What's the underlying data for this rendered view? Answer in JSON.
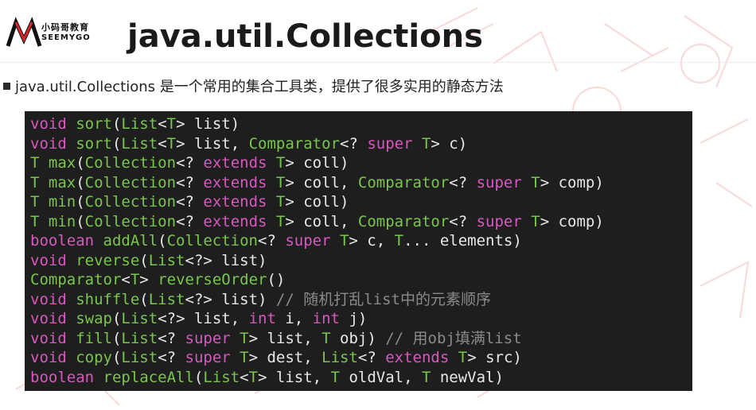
{
  "brand": {
    "name_cn": "小码哥教育",
    "name_en": "SEEMYGO"
  },
  "title": "java.util.Collections",
  "bullet": "java.util.Collections 是一个常用的集合工具类，提供了很多实用的静态方法",
  "colors": {
    "keyword": "#d957c0",
    "type": "#79c64e",
    "plain": "#e8e8e8",
    "comment": "#8a8a8a",
    "code_bg": "#1e1e1e"
  },
  "code_lines": [
    [
      [
        "kw",
        "void "
      ],
      [
        "ty",
        "sort"
      ],
      [
        "pl",
        "("
      ],
      [
        "ty",
        "List"
      ],
      [
        "pl",
        "<"
      ],
      [
        "ty",
        "T"
      ],
      [
        "pl",
        "> list)"
      ]
    ],
    [
      [
        "kw",
        "void "
      ],
      [
        "ty",
        "sort"
      ],
      [
        "pl",
        "("
      ],
      [
        "ty",
        "List"
      ],
      [
        "pl",
        "<"
      ],
      [
        "ty",
        "T"
      ],
      [
        "pl",
        "> list, "
      ],
      [
        "ty",
        "Comparator"
      ],
      [
        "pl",
        "<? "
      ],
      [
        "kw",
        "super "
      ],
      [
        "ty",
        "T"
      ],
      [
        "pl",
        "> c)"
      ]
    ],
    [
      [
        "ty",
        "T "
      ],
      [
        "ty",
        "max"
      ],
      [
        "pl",
        "("
      ],
      [
        "ty",
        "Collection"
      ],
      [
        "pl",
        "<? "
      ],
      [
        "kw",
        "extends "
      ],
      [
        "ty",
        "T"
      ],
      [
        "pl",
        "> coll)"
      ]
    ],
    [
      [
        "ty",
        "T "
      ],
      [
        "ty",
        "max"
      ],
      [
        "pl",
        "("
      ],
      [
        "ty",
        "Collection"
      ],
      [
        "pl",
        "<? "
      ],
      [
        "kw",
        "extends "
      ],
      [
        "ty",
        "T"
      ],
      [
        "pl",
        "> coll, "
      ],
      [
        "ty",
        "Comparator"
      ],
      [
        "pl",
        "<? "
      ],
      [
        "kw",
        "super "
      ],
      [
        "ty",
        "T"
      ],
      [
        "pl",
        "> comp)"
      ]
    ],
    [
      [
        "ty",
        "T "
      ],
      [
        "ty",
        "min"
      ],
      [
        "pl",
        "("
      ],
      [
        "ty",
        "Collection"
      ],
      [
        "pl",
        "<? "
      ],
      [
        "kw",
        "extends "
      ],
      [
        "ty",
        "T"
      ],
      [
        "pl",
        "> coll)"
      ]
    ],
    [
      [
        "ty",
        "T "
      ],
      [
        "ty",
        "min"
      ],
      [
        "pl",
        "("
      ],
      [
        "ty",
        "Collection"
      ],
      [
        "pl",
        "<? "
      ],
      [
        "kw",
        "extends "
      ],
      [
        "ty",
        "T"
      ],
      [
        "pl",
        "> coll, "
      ],
      [
        "ty",
        "Comparator"
      ],
      [
        "pl",
        "<? "
      ],
      [
        "kw",
        "super "
      ],
      [
        "ty",
        "T"
      ],
      [
        "pl",
        "> comp)"
      ]
    ],
    [
      [
        "kw",
        "boolean "
      ],
      [
        "ty",
        "addAll"
      ],
      [
        "pl",
        "("
      ],
      [
        "ty",
        "Collection"
      ],
      [
        "pl",
        "<? "
      ],
      [
        "kw",
        "super "
      ],
      [
        "ty",
        "T"
      ],
      [
        "pl",
        "> c, "
      ],
      [
        "ty",
        "T"
      ],
      [
        "pl",
        "... elements)"
      ]
    ],
    [
      [
        "kw",
        "void "
      ],
      [
        "ty",
        "reverse"
      ],
      [
        "pl",
        "("
      ],
      [
        "ty",
        "List"
      ],
      [
        "pl",
        "<?> list)"
      ]
    ],
    [
      [
        "ty",
        "Comparator"
      ],
      [
        "pl",
        "<"
      ],
      [
        "ty",
        "T"
      ],
      [
        "pl",
        "> "
      ],
      [
        "ty",
        "reverseOrder"
      ],
      [
        "pl",
        "()"
      ]
    ],
    [
      [
        "kw",
        "void "
      ],
      [
        "ty",
        "shuffle"
      ],
      [
        "pl",
        "("
      ],
      [
        "ty",
        "List"
      ],
      [
        "pl",
        "<?> list) "
      ],
      [
        "cm",
        "// 随机打乱list中的元素顺序"
      ]
    ],
    [
      [
        "kw",
        "void "
      ],
      [
        "ty",
        "swap"
      ],
      [
        "pl",
        "("
      ],
      [
        "ty",
        "List"
      ],
      [
        "pl",
        "<?> list, "
      ],
      [
        "kw",
        "int "
      ],
      [
        "pl",
        "i, "
      ],
      [
        "kw",
        "int "
      ],
      [
        "pl",
        "j)"
      ]
    ],
    [
      [
        "kw",
        "void "
      ],
      [
        "ty",
        "fill"
      ],
      [
        "pl",
        "("
      ],
      [
        "ty",
        "List"
      ],
      [
        "pl",
        "<? "
      ],
      [
        "kw",
        "super "
      ],
      [
        "ty",
        "T"
      ],
      [
        "pl",
        "> list, "
      ],
      [
        "ty",
        "T"
      ],
      [
        "pl",
        " obj) "
      ],
      [
        "cm",
        "// 用obj填满list"
      ]
    ],
    [
      [
        "kw",
        "void "
      ],
      [
        "ty",
        "copy"
      ],
      [
        "pl",
        "("
      ],
      [
        "ty",
        "List"
      ],
      [
        "pl",
        "<? "
      ],
      [
        "kw",
        "super "
      ],
      [
        "ty",
        "T"
      ],
      [
        "pl",
        "> dest, "
      ],
      [
        "ty",
        "List"
      ],
      [
        "pl",
        "<? "
      ],
      [
        "kw",
        "extends "
      ],
      [
        "ty",
        "T"
      ],
      [
        "pl",
        "> src)"
      ]
    ],
    [
      [
        "kw",
        "boolean "
      ],
      [
        "ty",
        "replaceAll"
      ],
      [
        "pl",
        "("
      ],
      [
        "ty",
        "List"
      ],
      [
        "pl",
        "<"
      ],
      [
        "ty",
        "T"
      ],
      [
        "pl",
        "> list, "
      ],
      [
        "ty",
        "T"
      ],
      [
        "pl",
        " oldVal, "
      ],
      [
        "ty",
        "T"
      ],
      [
        "pl",
        " newVal)"
      ]
    ]
  ]
}
